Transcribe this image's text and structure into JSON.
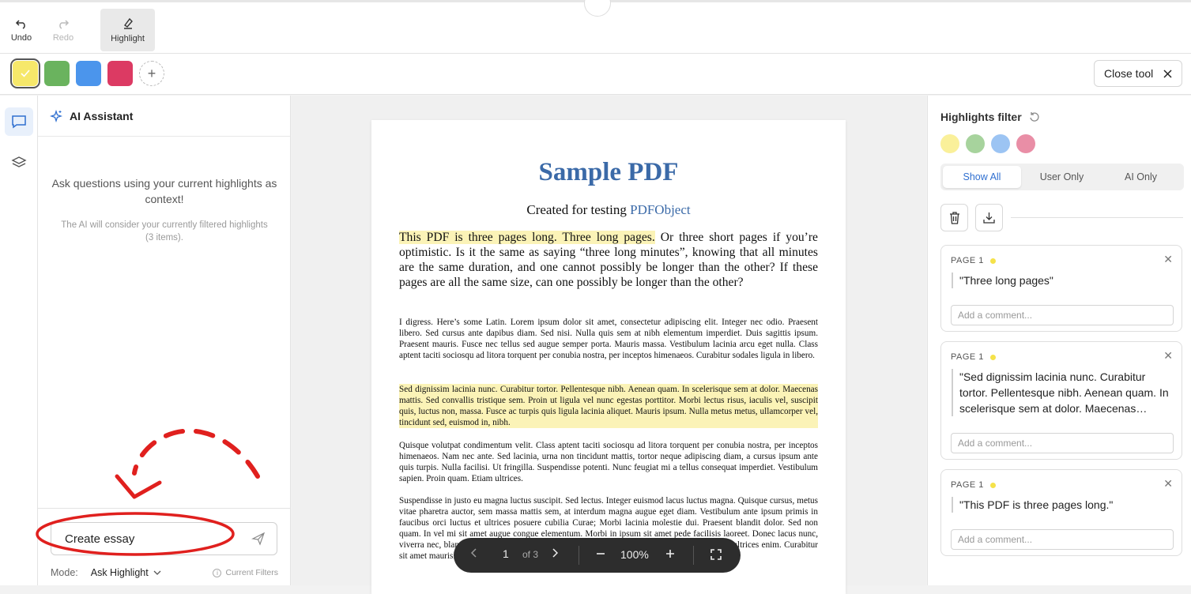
{
  "toolbar": {
    "undo_label": "Undo",
    "redo_label": "Redo",
    "highlight_label": "Highlight",
    "close_tool_label": "Close tool"
  },
  "colors": {
    "yellow": "#f6e86a",
    "green": "#6ab35e",
    "blue": "#4b95ec",
    "red": "#dc3a63",
    "accent": "#2f6fd0",
    "pdf_heading": "#3b6aa8",
    "highlight_fill": "#fbf3b7"
  },
  "ai": {
    "title": "AI Assistant",
    "prompt": "Ask questions using your current highlights as context!",
    "note": "The AI will consider your currently filtered highlights (3 items).",
    "input_value": "Create essay",
    "mode_label": "Mode:",
    "mode_value": "Ask Highlight",
    "filters_label": "Current Filters"
  },
  "pdf": {
    "title": "Sample PDF",
    "subtitle_prefix": "Created for testing ",
    "subtitle_link": "PDFObject",
    "lead_highlight": "This PDF is three pages long. Three long pages.",
    "lead_rest": " Or three short pages if you’re optimistic. Is it the same as saying “three long minutes”, knowing that all minutes are the same duration, and one cannot possibly be longer than the other? If these pages are all the same size, can one possibly be longer than the other?",
    "para1": "I digress. Here’s some Latin. Lorem ipsum dolor sit amet, consectetur adipiscing elit. Integer nec odio. Praesent libero. Sed cursus ante dapibus diam. Sed nisi. Nulla quis sem at nibh elementum imperdiet. Duis sagittis ipsum. Praesent mauris. Fusce nec tellus sed augue semper porta. Mauris massa. Vestibulum lacinia arcu eget nulla. Class aptent taciti sociosqu ad litora torquent per conubia nostra, per inceptos himenaeos. Curabitur sodales ligula in libero.",
    "para2": "Sed dignissim lacinia nunc. Curabitur tortor. Pellentesque nibh. Aenean quam. In scelerisque sem at dolor. Maecenas mattis. Sed convallis tristique sem. Proin ut ligula vel nunc egestas porttitor. Morbi lectus risus, iaculis vel, suscipit quis, luctus non, massa. Fusce ac turpis quis ligula lacinia aliquet. Mauris ipsum. Nulla metus metus, ullamcorper vel, tincidunt sed, euismod in, nibh.",
    "para3": "Quisque volutpat condimentum velit. Class aptent taciti sociosqu ad litora torquent per conubia nostra, per inceptos himenaeos. Nam nec ante. Sed lacinia, urna non tincidunt mattis, tortor neque adipiscing diam, a cursus ipsum ante quis turpis. Nulla facilisi. Ut fringilla. Suspendisse potenti. Nunc feugiat mi a tellus consequat imperdiet. Vestibulum sapien. Proin quam. Etiam ultrices.",
    "para4": "Suspendisse in justo eu magna luctus suscipit. Sed lectus. Integer euismod lacus luctus magna. Quisque cursus, metus vitae pharetra auctor, sem massa mattis sem, at interdum magna augue eget diam. Vestibulum ante ipsum primis in faucibus orci luctus et ultrices posuere cubilia Curae; Morbi lacinia molestie dui. Praesent blandit dolor. Sed non quam. In vel mi sit amet augue congue elementum. Morbi in ipsum sit amet pede facilisis laoreet. Donec lacus nunc, viverra nec, blandit vel, egestas et, augue. Vestibulum tincidunt malesuada tellus. Ut ultrices ultrices enim. Curabitur sit amet mauris."
  },
  "nav": {
    "page_current": "1",
    "page_total": "of 3",
    "zoom": "100%"
  },
  "filter": {
    "title": "Highlights filter",
    "tabs": [
      "Show All",
      "User Only",
      "AI Only"
    ],
    "active_tab": "Show All"
  },
  "cards": [
    {
      "page": "PAGE 1",
      "quote": "\"Three long pages\"",
      "comment_placeholder": "Add a comment..."
    },
    {
      "page": "PAGE 1",
      "quote": "\"Sed dignissim lacinia nunc. Curabitur tortor. Pellentesque nibh. Aenean quam. In scelerisque sem at dolor. Maecenas…",
      "comment_placeholder": "Add a comment..."
    },
    {
      "page": "PAGE 1",
      "quote": "\"This PDF is three pages long.\"",
      "comment_placeholder": "Add a comment..."
    }
  ]
}
